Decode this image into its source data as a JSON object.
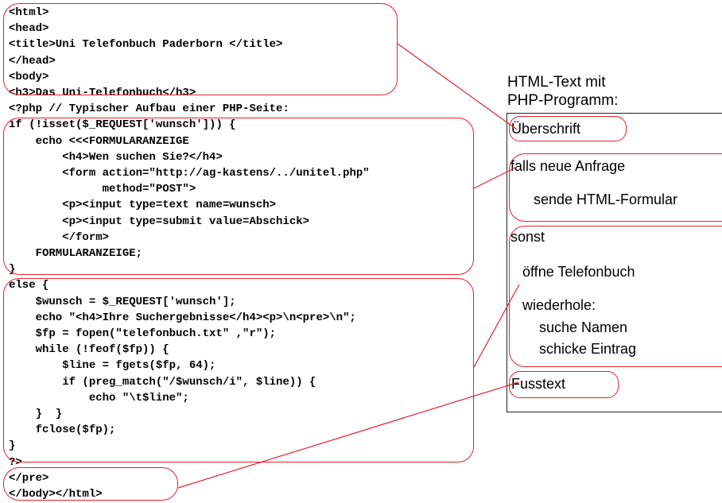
{
  "code": {
    "lines": [
      "<html>",
      "<head>",
      "<title>Uni Telefonbuch Paderborn </title>",
      "</head>",
      "<body>",
      "<h3>Das Uni-Telefonbuch</h3>",
      "<?php // Typischer Aufbau einer PHP-Seite:",
      "if (!isset($_REQUEST['wunsch'])) {",
      "    echo <<<FORMULARANZEIGE",
      "        <h4>Wen suchen Sie?</h4>",
      "        <form action=\"http://ag-kastens/../unitel.php\"",
      "              method=\"POST\">",
      "        <p><input type=text name=wunsch>",
      "        <p><input type=submit value=Abschick>",
      "        </form>",
      "    FORMULARANZEIGE;",
      "}",
      "else {",
      "    $wunsch = $_REQUEST['wunsch'];",
      "    echo \"<h4>Ihre Suchergebnisse</h4><p>\\n<pre>\\n\";",
      "    $fp = fopen(\"telefonbuch.txt\" ,\"r\");",
      "    while (!feof($fp)) {",
      "        $line = fgets($fp, 64);",
      "        if (preg_match(\"/$wunsch/i\", $line)) {",
      "            echo \"\\t$line\";",
      "    }  }",
      "    fclose($fp);",
      "}",
      "?>",
      "</pre>",
      "</body></html>"
    ]
  },
  "panel": {
    "heading": "HTML-Text mit\nPHP-Programm:",
    "ueberschrift": "Überschrift",
    "falls": "falls neue Anfrage",
    "sende": "sende HTML-Formular",
    "sonst": "sonst",
    "oeffne": "öffne Telefonbuch",
    "wiederhole": "wiederhole:",
    "suche": "suche Namen",
    "schicke": "schicke Eintrag",
    "fusstext": "Fusstext"
  },
  "colors": {
    "highlight": "#e8202a",
    "text": "#000000",
    "frame": "#222222"
  }
}
